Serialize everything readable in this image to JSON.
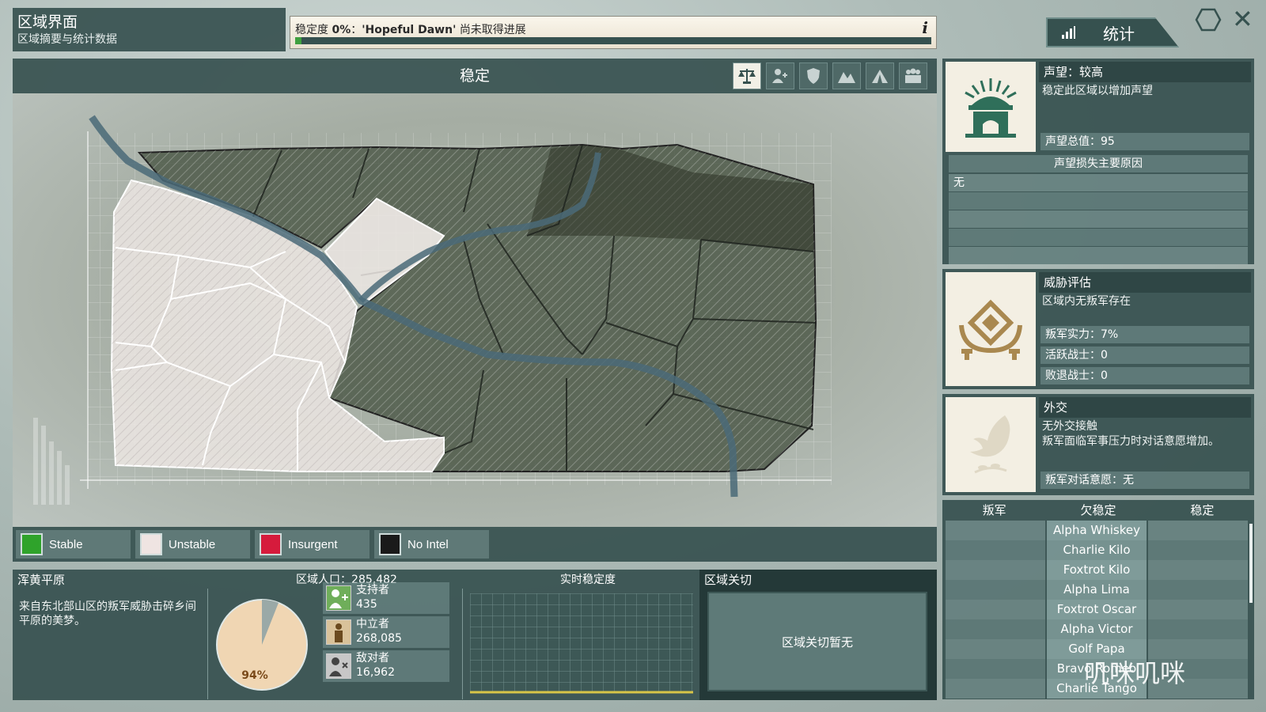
{
  "header": {
    "title": "区域界面",
    "subtitle": "区域摘要与统计数据",
    "stability_label": "稳定度",
    "stability_value": "0%",
    "stability_sep": "：",
    "objective_name": "'Hopeful Dawn'",
    "objective_status": "尚未取得进展",
    "info_glyph": "i",
    "stability_progress": 0.01,
    "stats_button": "统计"
  },
  "map": {
    "title": "稳定",
    "tools": [
      {
        "icon": "balance-scale-icon",
        "active": true
      },
      {
        "icon": "person-add-icon",
        "active": false
      },
      {
        "icon": "shield-icon",
        "active": false
      },
      {
        "icon": "mountains-icon",
        "active": false
      },
      {
        "icon": "tent-icon",
        "active": false
      },
      {
        "icon": "population-icon",
        "active": false
      }
    ],
    "legend": [
      {
        "label": "Stable",
        "color": "#2fa32b"
      },
      {
        "label": "Unstable",
        "color": "#efe4e2"
      },
      {
        "label": "Insurgent",
        "color": "#d61b3c"
      },
      {
        "label": "No Intel",
        "color": "#1a1a1a"
      }
    ]
  },
  "reputation": {
    "title": "声望：较高",
    "desc": "稳定此区域以增加声望",
    "total": "声望总值：95",
    "loss_title": "声望损失主要原因",
    "loss_items": [
      "无",
      "",
      "",
      "",
      "",
      ""
    ]
  },
  "threat": {
    "title": "威胁评估",
    "desc": "区域内无叛军存在",
    "rows": [
      "叛军实力：7%",
      "活跃战士：0",
      "败退战士：0"
    ]
  },
  "diplomacy": {
    "title": "外交",
    "desc1": "无外交接触",
    "desc2": "叛军面临军事压力时对话意愿增加。",
    "row": "叛军对话意愿：无"
  },
  "insurgents": {
    "headers": [
      "叛军",
      "欠稳定",
      "稳定"
    ],
    "rows": [
      "Alpha Whiskey",
      "Charlie Kilo",
      "Foxtrot Kilo",
      "Alpha Lima",
      "Foxtrot Oscar",
      "Alpha Victor",
      "Golf Papa",
      "Bravo Romeo",
      "Charlie Tango"
    ]
  },
  "region": {
    "name": "浑黄平原",
    "desc": "来自东北部山区的叛军威胁击碎乡间平原的美梦。",
    "population_title": "区域人口：285,482",
    "pie_percent": "94%",
    "pie_fraction": 0.94,
    "groups": [
      {
        "label": "支持者",
        "value": "435",
        "icon": "supporter-icon"
      },
      {
        "label": "中立者",
        "value": "268,085",
        "icon": "neutral-icon"
      },
      {
        "label": "敌对者",
        "value": "16,962",
        "icon": "hostile-icon"
      }
    ],
    "realtime_title": "实时稳定度",
    "cut_title": "区域关切",
    "cut_empty": "区域关切暂无"
  },
  "colors": {
    "panel": "#36514f",
    "accent_green": "#3fa03f",
    "emblem_green": "#2f6f5a",
    "emblem_gold": "#a9884f",
    "realtime_line": "#d8c548"
  },
  "watermark": "叽咪叽咪"
}
